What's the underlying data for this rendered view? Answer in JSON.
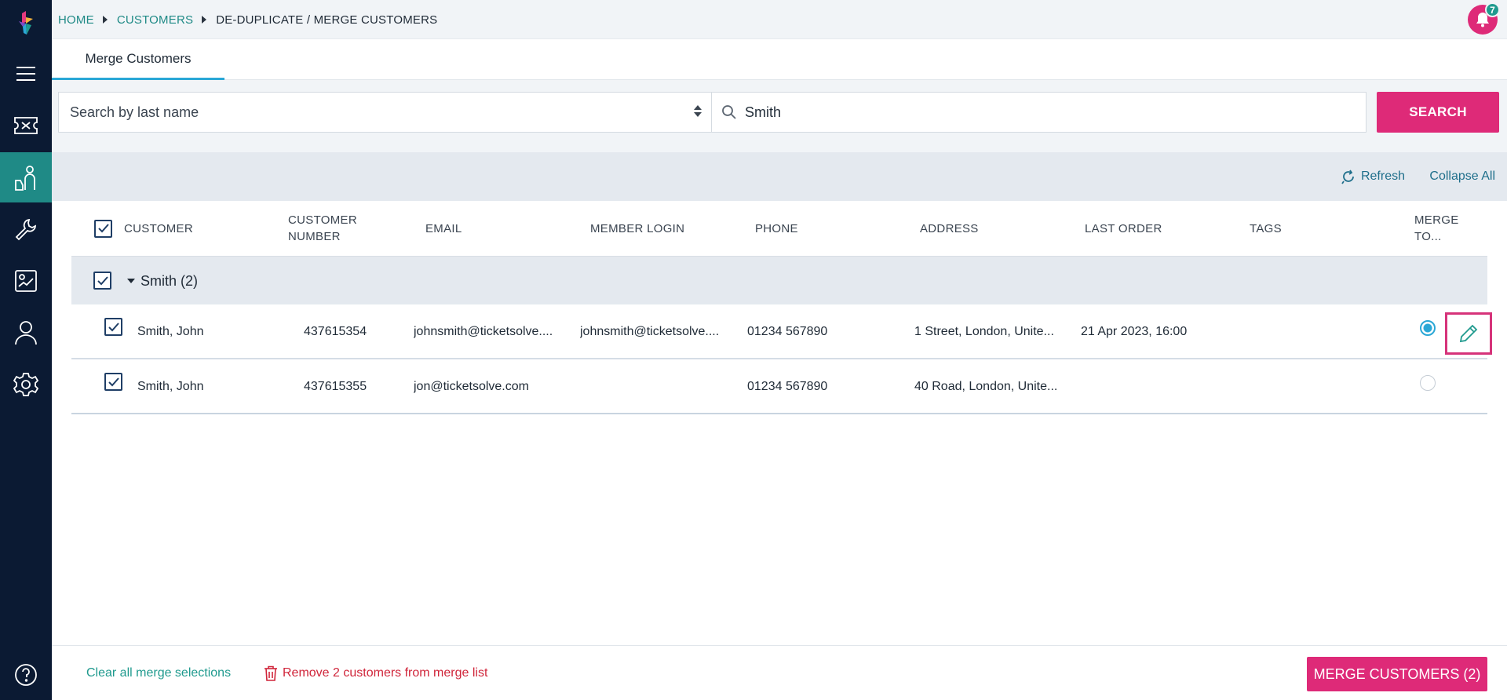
{
  "sidebar": {
    "logo_icon": "ticketsolve-logo-icon",
    "items": [
      {
        "icon": "menu-icon",
        "active": false
      },
      {
        "icon": "ticket-icon",
        "active": false
      },
      {
        "icon": "customers-icon",
        "active": true
      },
      {
        "icon": "wrench-icon",
        "active": false
      },
      {
        "icon": "reports-icon",
        "active": false
      },
      {
        "icon": "user-icon",
        "active": false
      },
      {
        "icon": "gear-icon",
        "active": false
      }
    ],
    "help_icon": "help-icon",
    "active_color": "#1f8a86",
    "background": "#0b1a33"
  },
  "breadcrumb": {
    "home": "HOME",
    "customers": "CUSTOMERS",
    "current": "DE-DUPLICATE / MERGE CUSTOMERS"
  },
  "notifications": {
    "count": "7",
    "icon": "bell-icon",
    "color": "#de2a78"
  },
  "tabs": [
    {
      "label": "Merge Customers",
      "active": true
    }
  ],
  "search": {
    "field_select": "Search by last name",
    "query": "Smith",
    "button": "SEARCH"
  },
  "toolbar": {
    "refresh": "Refresh",
    "collapse": "Collapse All"
  },
  "table": {
    "headers": {
      "customer": "CUSTOMER",
      "customer_number_1": "CUSTOMER",
      "customer_number_2": "NUMBER",
      "email": "EMAIL",
      "member_login": "MEMBER LOGIN",
      "phone": "PHONE",
      "address": "ADDRESS",
      "last_order": "LAST ORDER",
      "tags": "TAGS",
      "merge_to_1": "MERGE",
      "merge_to_2": "TO..."
    },
    "group": {
      "label": "Smith (2)",
      "checked": true
    },
    "rows": [
      {
        "checked": true,
        "name": "Smith, John",
        "number": "437615354",
        "email": "johnsmith@ticketsolve....",
        "member_login": "johnsmith@ticketsolve....",
        "phone": "01234 567890",
        "address": "1 Street, London, Unite...",
        "last_order": "21 Apr 2023, 16:00",
        "tags": "",
        "merge_target": true
      },
      {
        "checked": true,
        "name": "Smith, John",
        "number": "437615355",
        "email": "jon@ticketsolve.com",
        "member_login": "",
        "phone": "01234 567890",
        "address": "40 Road, London, Unite...",
        "last_order": "",
        "tags": "",
        "merge_target": false
      }
    ]
  },
  "footer": {
    "clear": "Clear all merge selections",
    "remove": "Remove 2 customers from merge list",
    "merge": "MERGE CUSTOMERS (2)"
  },
  "colors": {
    "accent": "#de2a78",
    "teal": "#1f9a8e",
    "blue": "#2aa7d6",
    "danger": "#d0253a"
  }
}
